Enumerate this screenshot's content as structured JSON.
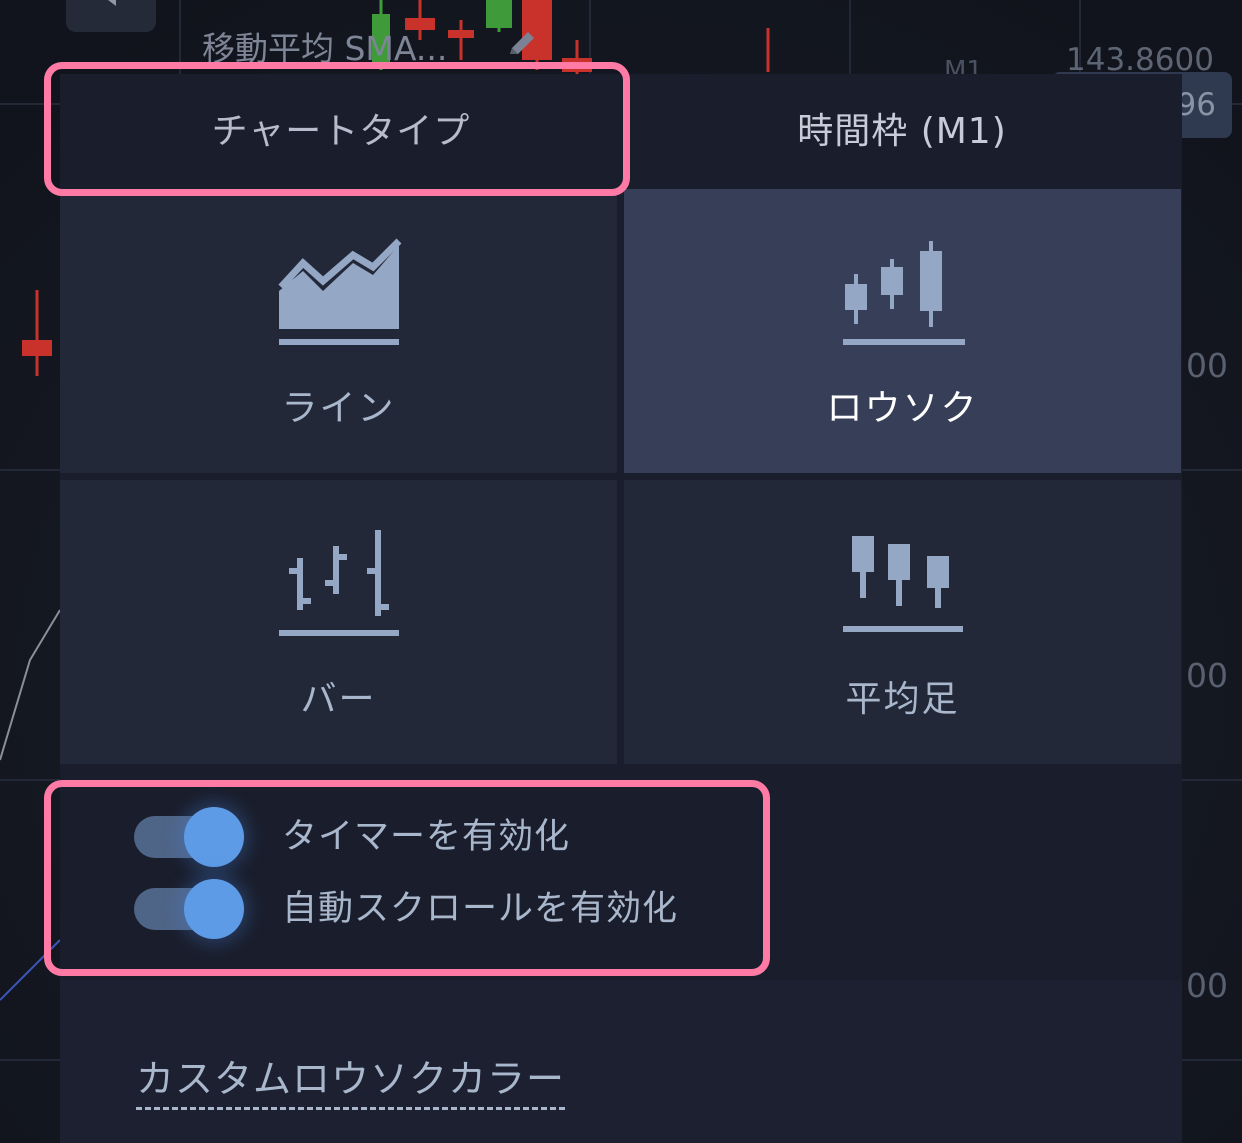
{
  "chart_background": {
    "sma_label": "移動平均 SMA...",
    "price_top": "143.8600",
    "price_badge": "96",
    "timeframe_ghost": "M1",
    "axis_labels": [
      "00",
      "00",
      "00"
    ]
  },
  "tabs": {
    "chart_type": "チャートタイプ",
    "timeframe": "時間枠 (M1)"
  },
  "chart_types": [
    {
      "label": "ライン",
      "icon": "line-chart-icon",
      "selected": false
    },
    {
      "label": "ロウソク",
      "icon": "candlestick-icon",
      "selected": true
    },
    {
      "label": "バー",
      "icon": "bar-chart-icon",
      "selected": false
    },
    {
      "label": "平均足",
      "icon": "heikin-ashi-icon",
      "selected": false
    }
  ],
  "toggles": {
    "timer": {
      "label": "タイマーを有効化",
      "on": true
    },
    "auto_scroll": {
      "label": "自動スクロールを有効化",
      "on": true
    }
  },
  "custom_colors_link": "カスタムロウソクカラー",
  "colors": {
    "panel_bg": "#1a1e2c",
    "tile_bg": "#232839",
    "tile_selected_bg": "#363f57",
    "icon": "#94a7c4",
    "toggle_knob": "#5d9be6",
    "highlight": "#ff7aa5"
  }
}
